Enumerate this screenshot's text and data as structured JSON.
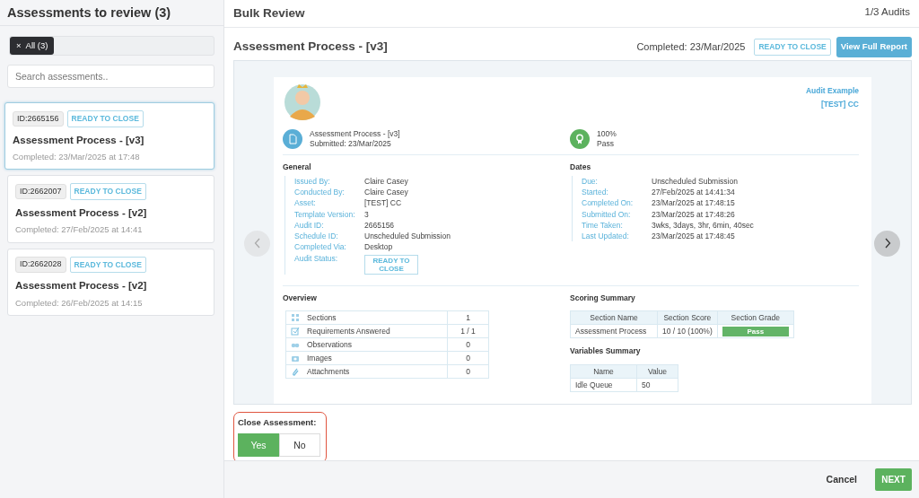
{
  "sidebar": {
    "title": "Assessments to review (3)",
    "filter_chip": {
      "remove": "×",
      "label": "All (3)"
    },
    "search": {
      "placeholder": "Search assessments.."
    },
    "items": [
      {
        "id": "ID:2665156",
        "status": "READY TO CLOSE",
        "title": "Assessment Process - [v3]",
        "completed": "Completed: 23/Mar/2025 at 17:48",
        "selected": true
      },
      {
        "id": "ID:2662007",
        "status": "READY TO CLOSE",
        "title": "Assessment Process - [v2]",
        "completed": "Completed: 27/Feb/2025 at 14:41",
        "selected": false
      },
      {
        "id": "ID:2662028",
        "status": "READY TO CLOSE",
        "title": "Assessment Process - [v2]",
        "completed": "Completed: 26/Feb/2025 at 14:15",
        "selected": false
      }
    ]
  },
  "main": {
    "title": "Bulk Review",
    "counter": "1/3 Audits"
  },
  "audit": {
    "title": "Assessment Process - [v3]",
    "completed": "Completed: 23/Mar/2025",
    "status": "READY TO CLOSE",
    "view_button": "View Full Report"
  },
  "report": {
    "header_links": [
      "Audit Example",
      "[TEST] CC"
    ],
    "summary": [
      {
        "kind": "document",
        "lines": [
          "Assessment Process - [v3]",
          "Submitted: 23/Mar/2025"
        ]
      },
      {
        "kind": "award",
        "lines": [
          "100%",
          "Pass"
        ]
      }
    ],
    "general": {
      "heading": "General",
      "fields": [
        {
          "kind": "text",
          "label": "Issued By:",
          "value": "Claire Casey"
        },
        {
          "kind": "text",
          "label": "Conducted By:",
          "value": "Claire Casey"
        },
        {
          "kind": "text",
          "label": "Asset:",
          "value": "[TEST] CC"
        },
        {
          "kind": "text",
          "label": "Template Version:",
          "value": "3"
        },
        {
          "kind": "text",
          "label": "Audit ID:",
          "value": "2665156"
        },
        {
          "kind": "text",
          "label": "Schedule ID:",
          "value": "Unscheduled Submission"
        },
        {
          "kind": "text",
          "label": "Completed Via:",
          "value": "Desktop"
        },
        {
          "kind": "badge",
          "label": "Audit Status:",
          "value": "READY TO CLOSE"
        }
      ]
    },
    "dates": {
      "heading": "Dates",
      "fields": [
        {
          "kind": "text",
          "label": "Due:",
          "value": "Unscheduled Submission"
        },
        {
          "kind": "text",
          "label": "Started:",
          "value": "27/Feb/2025 at 14:41:34"
        },
        {
          "kind": "text",
          "label": "Completed On:",
          "value": "23/Mar/2025 at 17:48:15"
        },
        {
          "kind": "text",
          "label": "Submitted On:",
          "value": "23/Mar/2025 at 17:48:26"
        },
        {
          "kind": "text",
          "label": "Time Taken:",
          "value": "3wks, 3days, 3hr, 6min, 40sec"
        },
        {
          "kind": "text",
          "label": "Last Updated:",
          "value": "23/Mar/2025 at 17:48:45"
        }
      ]
    },
    "overview": {
      "heading": "Overview",
      "rows": [
        {
          "kind": "sections",
          "label": "Sections",
          "value": "1"
        },
        {
          "kind": "requirements",
          "label": "Requirements Answered",
          "value": "1 / 1"
        },
        {
          "kind": "observations",
          "label": "Observations",
          "value": "0"
        },
        {
          "kind": "images",
          "label": "Images",
          "value": "0"
        },
        {
          "kind": "attachments",
          "label": "Attachments",
          "value": "0"
        }
      ]
    },
    "scoring": {
      "heading": "Scoring Summary",
      "columns": [
        "Section Name",
        "Section Score",
        "Section Grade"
      ],
      "rows": [
        {
          "name": "Assessment Process",
          "score": "10 / 10 (100%)",
          "grade": "Pass"
        }
      ]
    },
    "variables": {
      "heading": "Variables Summary",
      "columns": [
        "Name",
        "Value"
      ],
      "rows": [
        {
          "name": "Idle Queue",
          "value": "50"
        }
      ]
    }
  },
  "close_assessment": {
    "label": "Close Assessment:",
    "options": [
      {
        "label": "Yes",
        "selected": true
      },
      {
        "label": "No",
        "selected": false
      }
    ]
  },
  "footer": {
    "cancel": "Cancel",
    "next": "NEXT"
  }
}
